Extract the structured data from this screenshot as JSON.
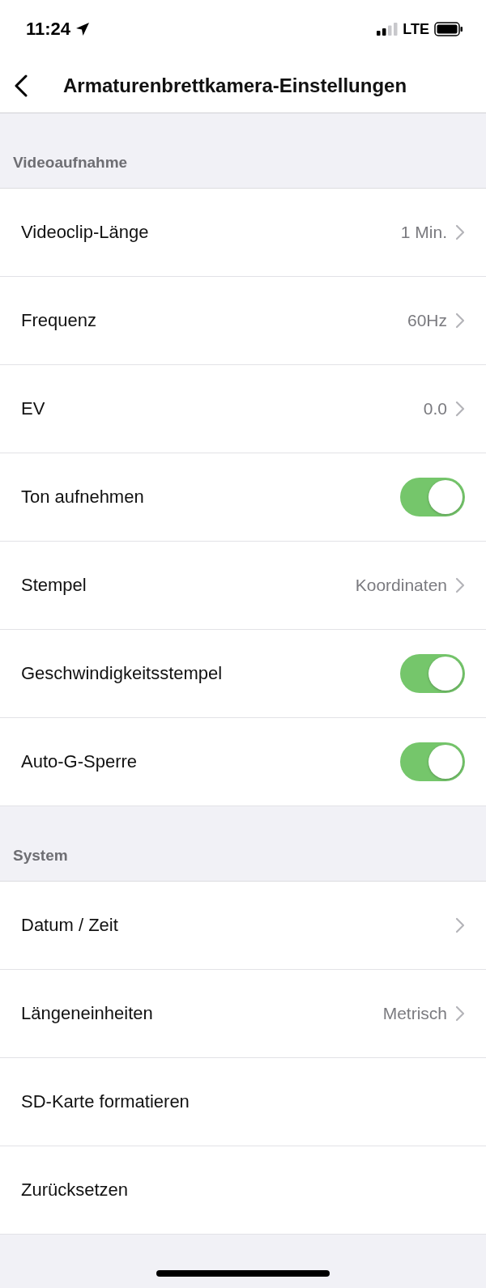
{
  "status_bar": {
    "time": "11:24",
    "network": "LTE"
  },
  "nav": {
    "title": "Armaturenbrettkamera-Einstellungen"
  },
  "sections": [
    {
      "title": "Videoaufnahme",
      "rows": [
        {
          "kind": "link",
          "label": "Videoclip-Länge",
          "value": "1 Min."
        },
        {
          "kind": "link",
          "label": "Frequenz",
          "value": "60Hz"
        },
        {
          "kind": "link",
          "label": "EV",
          "value": "0.0"
        },
        {
          "kind": "toggle",
          "label": "Ton aufnehmen",
          "on": true
        },
        {
          "kind": "link",
          "label": "Stempel",
          "value": "Koordinaten"
        },
        {
          "kind": "toggle",
          "label": "Geschwindigkeitsstempel",
          "on": true
        },
        {
          "kind": "toggle",
          "label": "Auto-G-Sperre",
          "on": true
        }
      ]
    },
    {
      "title": "System",
      "rows": [
        {
          "kind": "link",
          "label": "Datum / Zeit"
        },
        {
          "kind": "link",
          "label": "Längeneinheiten",
          "value": "Metrisch"
        },
        {
          "kind": "plain",
          "label": "SD-Karte formatieren"
        },
        {
          "kind": "plain",
          "label": "Zurücksetzen"
        }
      ]
    }
  ]
}
